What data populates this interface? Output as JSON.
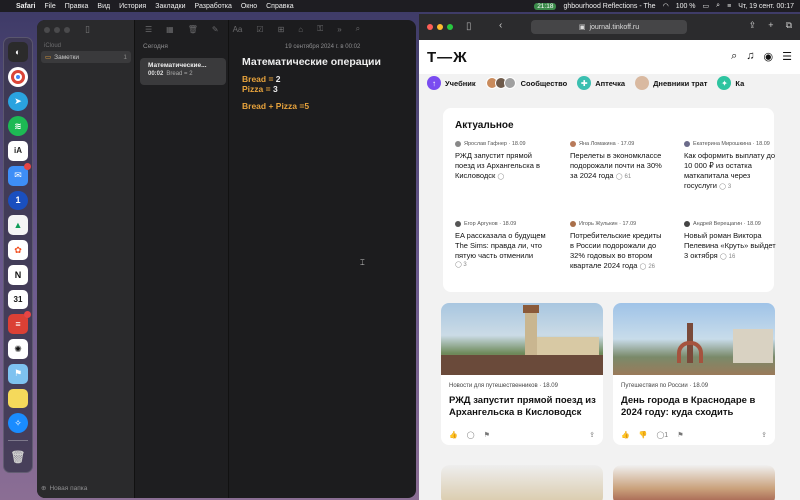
{
  "menubar": {
    "app": "Safari",
    "items": [
      "File",
      "Правка",
      "Вид",
      "История",
      "Закладки",
      "Разработка",
      "Окно",
      "Справка"
    ],
    "badge": "21:18",
    "tabs_text": "ghbourhood   Reflections - The",
    "battery": "100 %",
    "datetime": "Чт, 19 сент. 00:17"
  },
  "notes": {
    "account": "iCloud",
    "folder": "Заметки",
    "folder_count": "1",
    "list_header": "Сегодня",
    "note_title": "Математические...",
    "note_time": "00:02",
    "note_snippet": "Bread = 2",
    "date": "19 сентября 2024 г. в 00:02",
    "title": "Математические операции",
    "l1_label": "Bread =",
    "l1_value": "2",
    "l2_label": "Pizza =",
    "l2_value": "3",
    "l3_label": "Bread + Pizza =",
    "l3_value": "5",
    "new_folder": "Новая папка"
  },
  "safari": {
    "url": "journal.tinkoff.ru",
    "logo": "Т—Ж",
    "chips": [
      "Учебник",
      "Сообщество",
      "Аптечка",
      "Дневники трат",
      "Ка"
    ],
    "section_title": "Актуальное",
    "news": [
      {
        "author": "Ярослав Гафнер · 18.09",
        "title": "РЖД запустит прямой поезд из Архангельска в Кисловодск",
        "comments": ""
      },
      {
        "author": "Яна Ломакина · 17.09",
        "title": "Перелеты в экономклассе подорожали почти на 30% за 2024 года",
        "comments": "61"
      },
      {
        "author": "Екатерина Мирошкина · 18.09",
        "title": "Как оформить выплату до 10 000 ₽ из остатка маткапитала через госуслуги",
        "comments": "3"
      },
      {
        "author": "Егор Аргунов · 18.09",
        "title": "EA рассказала о будущем The Sims: правда ли, что пятую часть отменили",
        "comments": "3"
      },
      {
        "author": "Игорь Жулькин · 17.09",
        "title": "Потребительские кредиты в России подорожали до 32% годовых во втором квартале 2024 года",
        "comments": "26"
      },
      {
        "author": "Андрей Верещагин · 18.09",
        "title": "Новый роман Виктора Пелевина «Круть» выйдет 3 октября",
        "comments": "16"
      }
    ],
    "articles": [
      {
        "category": "Новости для путешественников · 18.09",
        "title": "РЖД запустит прямой поезд из Архангельска в Кисловодск",
        "comments": ""
      },
      {
        "category": "Путешествия по России · 18.09",
        "title": "День города в Краснодаре в 2024 году: куда сходить",
        "comments": "1"
      }
    ]
  },
  "colors": {
    "accent_orange": "#e8a33c",
    "brand_yellow": "#ffdd2d"
  }
}
